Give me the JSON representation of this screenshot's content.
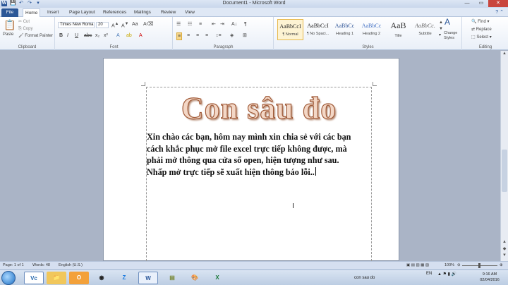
{
  "window": {
    "title": "Document1 - Microsoft Word"
  },
  "quick_access": [
    "W",
    "💾",
    "↶",
    "↷",
    "▾"
  ],
  "tabs": [
    {
      "label": "File"
    },
    {
      "label": "Home"
    },
    {
      "label": "Insert"
    },
    {
      "label": "Page Layout"
    },
    {
      "label": "References"
    },
    {
      "label": "Mailings"
    },
    {
      "label": "Review"
    },
    {
      "label": "View"
    }
  ],
  "ribbon": {
    "clipboard": {
      "paste": "Paste",
      "cut": "Cut",
      "copy": "Copy",
      "format_painter": "Format Painter",
      "label": "Clipboard"
    },
    "font": {
      "font_name": "Times New Roma",
      "font_size": "20",
      "label": "Font"
    },
    "paragraph": {
      "label": "Paragraph"
    },
    "styles": {
      "label": "Styles",
      "items": [
        {
          "sample": "AaBbCcI",
          "name": "¶ Normal"
        },
        {
          "sample": "AaBbCcI",
          "name": "¶ No Spaci..."
        },
        {
          "sample": "AaBbCc",
          "name": "Heading 1"
        },
        {
          "sample": "AaBbCc",
          "name": "Heading 2"
        },
        {
          "sample": "AaB",
          "name": "Title"
        },
        {
          "sample": "AaBbCc.",
          "name": "Subtitle"
        }
      ],
      "change_styles": "Change Styles"
    },
    "editing": {
      "find": "Find",
      "replace": "Replace",
      "select": "Select",
      "label": "Editing"
    }
  },
  "document": {
    "wordart": "Con sâu đo",
    "lines": [
      "Xin chào các bạn, hôm nay mình xin chia sẻ với các bạn",
      "cách khắc phục mở file excel trực tiếp không được, mà",
      "phải mở thông qua cửa sổ open, hiện tượng như sau.",
      "Nhấp mở trực tiếp sẽ xuất hiện thông báo lỗi.."
    ]
  },
  "statusbar": {
    "page": "Page: 1 of 1",
    "words": "Words: 48",
    "language": "English (U.S.)",
    "zoom": "100%"
  },
  "taskbar": {
    "active_task": "con sau do",
    "lang": "EN",
    "time": "9:16 AM",
    "date": "02/04/2016"
  }
}
